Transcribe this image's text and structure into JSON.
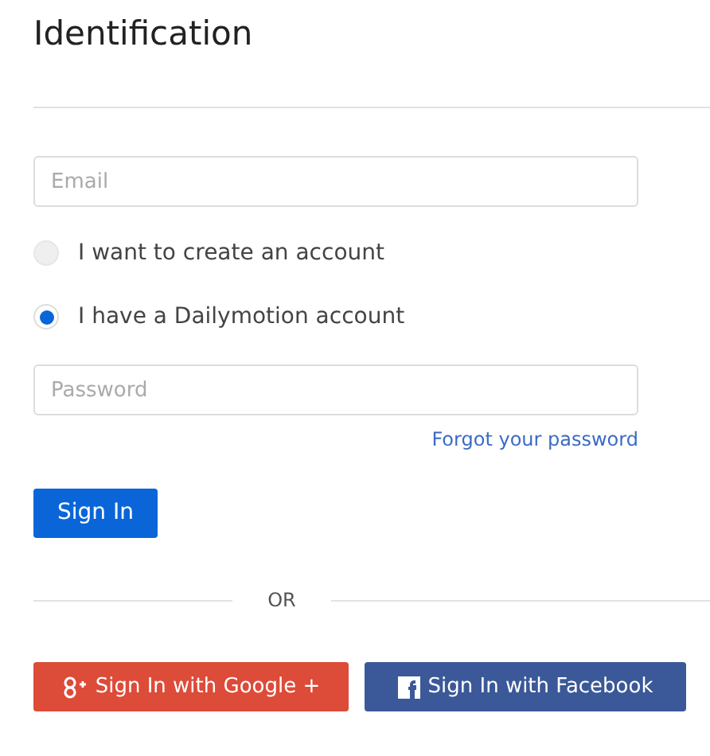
{
  "title": "Identification",
  "email_field": {
    "placeholder": "Email"
  },
  "account_options": [
    {
      "label": "I want to create an account",
      "selected": false
    },
    {
      "label": "I have a Dailymotion account",
      "selected": true
    }
  ],
  "password_field": {
    "placeholder": "Password"
  },
  "forgot_link": "Forgot your password",
  "sign_in_button": "Sign In",
  "separator": "OR",
  "social_buttons": [
    {
      "kind": "google",
      "label": "Sign In with Google +"
    },
    {
      "kind": "facebook",
      "label": "Sign In with Facebook"
    }
  ]
}
